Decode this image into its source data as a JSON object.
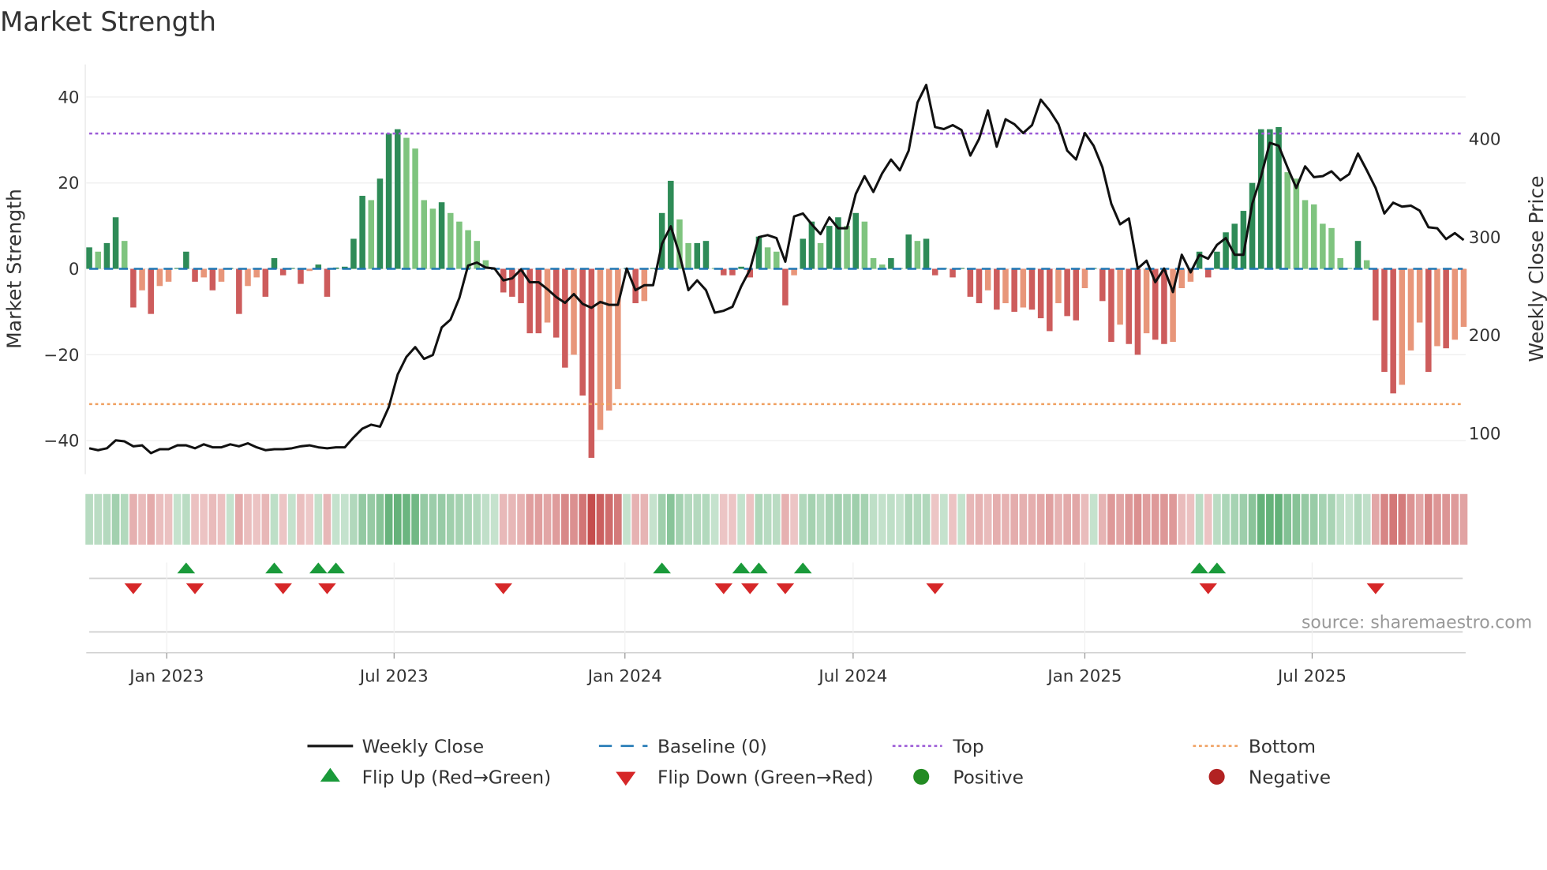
{
  "chart_data": {
    "type": "bar",
    "title": "Market Strength",
    "ylabel": "Market Strength",
    "y2label": "Weekly Close Price",
    "ylim": [
      -47,
      47
    ],
    "y2lim": [
      65,
      460
    ],
    "yticks": [
      40,
      20,
      0,
      -20,
      -40
    ],
    "y2ticks": [
      100,
      200,
      300,
      400
    ],
    "xunit": "week index",
    "xticks": [
      {
        "label": "Jan 2023",
        "x": 8.8
      },
      {
        "label": "Jul 2023",
        "x": 34.6
      },
      {
        "label": "Jan 2024",
        "x": 60.8
      },
      {
        "label": "Jul 2024",
        "x": 86.7
      },
      {
        "label": "Jan 2025",
        "x": 113
      },
      {
        "label": "Jul 2025",
        "x": 138.8
      }
    ],
    "top_level": 31.5,
    "bottom_level": -31.5,
    "baseline": 0,
    "strength": [
      5,
      4,
      6,
      12,
      6.5,
      -9,
      -5,
      -10.5,
      -4,
      -3,
      0.2,
      4,
      -3,
      -2,
      -5,
      -3,
      0.2,
      -10.5,
      -4,
      -2,
      -6.5,
      2.5,
      -1.5,
      0.2,
      -3.5,
      -0.5,
      1,
      -6.5,
      0.3,
      0.5,
      7,
      17,
      16,
      21,
      31.5,
      32.5,
      30.5,
      28,
      16,
      14,
      15.5,
      13,
      11,
      9,
      6.5,
      2,
      0.2,
      -5.5,
      -6.5,
      -8,
      -15,
      -15,
      -12.5,
      -16,
      -23,
      -20,
      -29.5,
      -44,
      -37.5,
      -33,
      -28,
      0.2,
      -8,
      -7.5,
      0.2,
      13,
      20.5,
      11.5,
      6,
      6,
      6.5,
      0.2,
      -1.5,
      -1.5,
      0.5,
      -2,
      7.5,
      5,
      4,
      -8.5,
      -1.5,
      7,
      11,
      6,
      10,
      12,
      10,
      13,
      11,
      2.5,
      1,
      2.5,
      0.2,
      8,
      6.5,
      7,
      -1.5,
      0.2,
      -2,
      0.2,
      -6.5,
      -8,
      -5,
      -9.5,
      -8,
      -10,
      -9,
      -9.5,
      -11.5,
      -14.5,
      -8,
      -11,
      -12,
      -4.5,
      0.2,
      -7.5,
      -17,
      -13,
      -17.5,
      -20,
      -15,
      -16.5,
      -17.5,
      -17,
      -4.5,
      -3,
      4,
      -2,
      4,
      8.5,
      10.5,
      13.5,
      20,
      32.5,
      32.5,
      33,
      22.5,
      21,
      16,
      15,
      10.5,
      9.5,
      2.5,
      0.2,
      6.5,
      2,
      -12,
      -24,
      -29,
      -27,
      -19,
      -12.5,
      -24,
      -18,
      -18.5,
      -16.5,
      -13.5
    ],
    "close": [
      85,
      83,
      85,
      93,
      92,
      87,
      88,
      80,
      84,
      84,
      88,
      88,
      85,
      89,
      86,
      86,
      89,
      87,
      90,
      86,
      83,
      84,
      84,
      85,
      87,
      88,
      86,
      85,
      86,
      86,
      96,
      105,
      109,
      107,
      127,
      160,
      178,
      188,
      176,
      180,
      208,
      216,
      238,
      271,
      274,
      269,
      268,
      256,
      258,
      267,
      254,
      254,
      247,
      239,
      233,
      242,
      232,
      228,
      234,
      231,
      231,
      268,
      246,
      251,
      251,
      293,
      311,
      282,
      246,
      256,
      246,
      223,
      225,
      229,
      250,
      267,
      300,
      302,
      299,
      275,
      321,
      324,
      313,
      303,
      320,
      309,
      309,
      344,
      362,
      346,
      365,
      379,
      368,
      388,
      437,
      455,
      412,
      410,
      414,
      409,
      383,
      400,
      429,
      392,
      420,
      415,
      406,
      414,
      440,
      429,
      415,
      388,
      379,
      406,
      393,
      371,
      334,
      313,
      319,
      268,
      276,
      254,
      268,
      244,
      282,
      264,
      282,
      278,
      292,
      299,
      282,
      282,
      334,
      362,
      396,
      393,
      371,
      350,
      372,
      361,
      362,
      367,
      358,
      364,
      385,
      368,
      350,
      324,
      335,
      331,
      332,
      327,
      310,
      309,
      298,
      304,
      297
    ],
    "flip_up_weeks": [
      11,
      21,
      26,
      28,
      65,
      74,
      76,
      81,
      126,
      128
    ],
    "flip_down_weeks": [
      5,
      12,
      22,
      27,
      47,
      72,
      75,
      79,
      96,
      127,
      146
    ],
    "colors": {
      "up_strong": "#2e8b57",
      "up_weak": "#7fc47f",
      "down_strong": "#cd5c5c",
      "down_weak": "#e8967a",
      "close": "#111111",
      "baseline": "#1f77b4",
      "top": "#9b59d6",
      "bottom": "#f0a060",
      "flip_up": "#1a9a3a",
      "flip_down": "#d62728",
      "positive": "#228b22",
      "negative": "#b22222"
    },
    "legend": [
      {
        "label": "Weekly Close",
        "kind": "line"
      },
      {
        "label": "Baseline (0)",
        "kind": "dash"
      },
      {
        "label": "Top",
        "kind": "dotted-top"
      },
      {
        "label": "Bottom",
        "kind": "dotted-bottom"
      },
      {
        "label": "Flip Up (Red→Green)",
        "kind": "tri-up"
      },
      {
        "label": "Flip Down (Green→Red)",
        "kind": "tri-down"
      },
      {
        "label": "Positive",
        "kind": "dot-pos"
      },
      {
        "label": "Negative",
        "kind": "dot-neg"
      }
    ],
    "legend_position": "bottom",
    "source": "source: sharemaestro.com"
  }
}
